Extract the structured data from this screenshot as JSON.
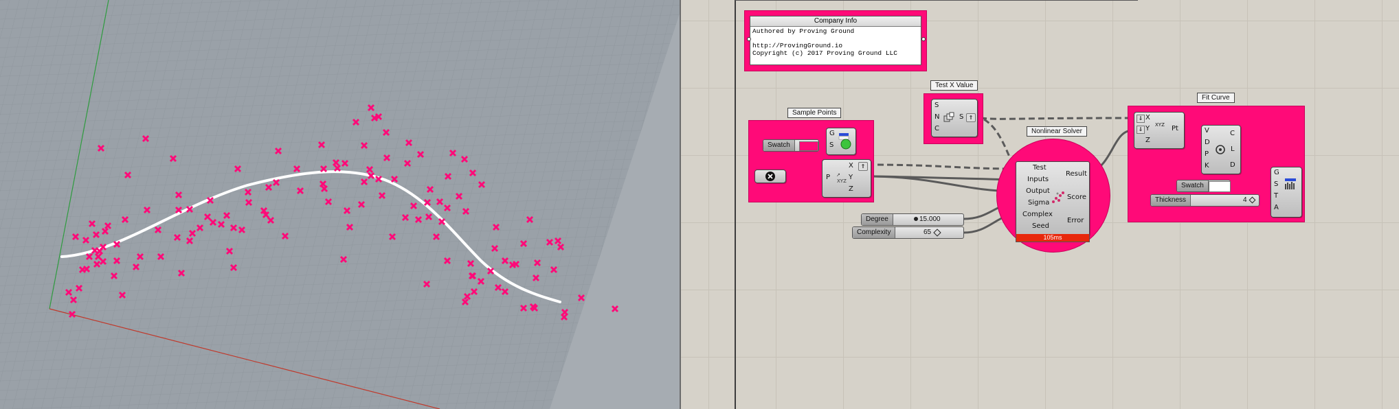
{
  "viewport": {
    "accent": "#ff0a78",
    "curve_color": "#ffffff",
    "axis_x_color": "#c0392b",
    "axis_y_color": "#2e9b3e"
  },
  "canvas": {
    "company_info": {
      "title": "Company Info",
      "lines": [
        "Authored by Proving Ground",
        "",
        "http://ProvingGround.io",
        "Copyright (c) 2017 Proving Ground LLC"
      ]
    },
    "sample_points": {
      "title": "Sample Points",
      "swatch_label": "Swatch",
      "preview_ports": [
        "G",
        "S"
      ],
      "deconstruct_ports_in": [
        "P"
      ],
      "deconstruct_ports_out": [
        "X",
        "Y",
        "Z"
      ]
    },
    "test_x": {
      "title": "Test X Value",
      "ports_in": [
        "S",
        "N",
        "C"
      ],
      "port_out": "S"
    },
    "nonlinear": {
      "title": "Nonlinear Solver",
      "inputs": [
        "Test",
        "Inputs",
        "Output",
        "Sigma",
        "Complex",
        "Seed"
      ],
      "outputs": [
        "Result",
        "Score",
        "Error"
      ],
      "timing": "105ms"
    },
    "sliders": {
      "degree_label": "Degree",
      "degree_value": "15.000",
      "complexity_label": "Complexity",
      "complexity_value": "65",
      "thickness_label": "Thickness",
      "thickness_value": "4"
    },
    "fit_curve": {
      "title": "Fit Curve",
      "construct_in": [
        "X",
        "Y",
        "Z"
      ],
      "construct_out": "Pt",
      "construct_icon": "XYZ",
      "interp_in": [
        "V",
        "D",
        "P",
        "K"
      ],
      "interp_out": [
        "C",
        "L",
        "D"
      ],
      "swatch_label": "Swatch",
      "preview_ports": [
        "G",
        "S",
        "T",
        "A"
      ]
    },
    "colors": {
      "group": "#ff0a78",
      "timing_bar": "#e8280c"
    }
  }
}
